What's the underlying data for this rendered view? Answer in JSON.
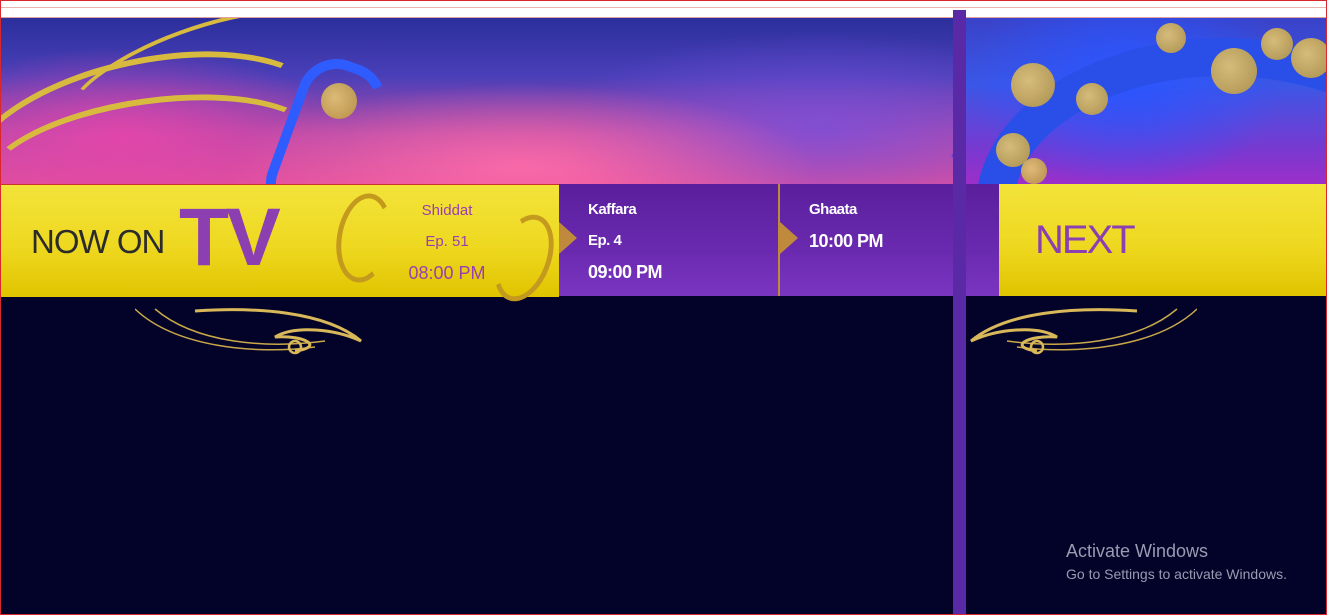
{
  "header": {
    "now_on_label": "NOW ON",
    "tv_label": "TV",
    "next_label": "NEXT"
  },
  "current_show": {
    "name": "Shiddat",
    "episode": "Ep. 51",
    "time": "08:00 PM"
  },
  "upcoming": [
    {
      "name": "Kaffara",
      "episode": "Ep. 4",
      "time": "09:00 PM"
    },
    {
      "name": "Ghaata",
      "time": "10:00 PM"
    }
  ],
  "watermark": {
    "title": "Activate Windows",
    "subtitle": "Go to Settings to activate Windows."
  },
  "colors": {
    "accent_yellow": "#eed820",
    "accent_purple": "#8c3fb0",
    "slot_purple": "#6a2ab0",
    "background": "#03032a",
    "arrow_gold": "#c08a3c"
  }
}
